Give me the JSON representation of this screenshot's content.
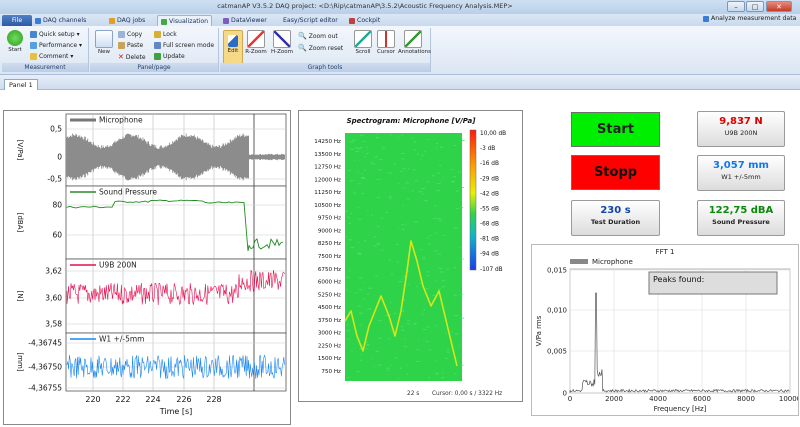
{
  "window": {
    "title": "catmanAP V3.5.2 DAQ project: <D:\\Rip\\catmanAP\\3.5.2\\Acoustic Frequency Analysis.MEP>",
    "buttons": {
      "minimize": "–",
      "maximize": "□",
      "close": "✕"
    }
  },
  "menu_tabs": [
    {
      "label": "File"
    },
    {
      "label": "DAQ channels"
    },
    {
      "label": "DAQ jobs"
    },
    {
      "label": "Visualization"
    },
    {
      "label": "DataViewer"
    },
    {
      "label": "Easy/Script editor"
    },
    {
      "label": "Cockpit"
    }
  ],
  "analyze_label": "Analyze measurement data",
  "ribbon": {
    "measurement": {
      "label": "Measurement",
      "start": "Start",
      "quick_setup": "Quick setup",
      "performance": "Performance",
      "comment": "Comment"
    },
    "panel_page": {
      "label": "Panel/page",
      "new": "New",
      "copy": "Copy",
      "paste": "Paste",
      "delete": "Delete",
      "lock": "Lock",
      "full_screen": "Full screen mode",
      "update": "Update"
    },
    "graph_tools": {
      "label": "Graph tools",
      "edit": "Edit",
      "rzoom": "R-Zoom",
      "hzoom": "H-Zoom",
      "zoom_out": "Zoom out",
      "zoom_reset": "Zoom reset",
      "scroll": "Scroll",
      "cursor": "Cursor",
      "annotations": "Annotations"
    }
  },
  "panel_tab": "Panel 1",
  "timechart": {
    "xlabel": "Time [s]",
    "x_ticks": [
      "220",
      "222",
      "224",
      "226",
      "228"
    ],
    "panels": [
      {
        "name": "Microphone",
        "unit": "[V/Pa]",
        "ticks": [
          "0,5",
          "0",
          "-0,5"
        ]
      },
      {
        "name": "Sound Pressure",
        "unit": "[dBA]",
        "ticks": [
          "80",
          "60"
        ]
      },
      {
        "name": "U9B 200N",
        "unit": "[N]",
        "ticks": [
          "3,62",
          "3,60",
          "3,58"
        ]
      },
      {
        "name": "W1 +/-5mm",
        "unit": "[mm]",
        "ticks": [
          "-4,36745",
          "-4,36750",
          "-4,36755"
        ]
      }
    ]
  },
  "spectrogram": {
    "title": "Spectrogram: Microphone [V/Pa]",
    "y_ticks": [
      "14250 Hz",
      "13500 Hz",
      "12750 Hz",
      "12000 Hz",
      "11250 Hz",
      "10500 Hz",
      "9750 Hz",
      "9000 Hz",
      "8250 Hz",
      "7500 Hz",
      "6750 Hz",
      "6000 Hz",
      "5250 Hz",
      "4500 Hz",
      "3750 Hz",
      "3000 Hz",
      "2250 Hz",
      "1500 Hz",
      "750 Hz"
    ],
    "colorbar": [
      "10,00 dB",
      "-3 dB",
      "-16 dB",
      "-29 dB",
      "-42 dB",
      "-55 dB",
      "-68 dB",
      "-81 dB",
      "-94 dB",
      "-107 dB"
    ],
    "time_label": "22 s",
    "cursor_label": "Cursor: 0,00 s / 3322 Hz"
  },
  "controls": {
    "start": "Start",
    "stop": "Stopp",
    "start_color": "#00ee00",
    "stop_color": "#ff0000"
  },
  "values": [
    {
      "value": "9,837 N",
      "label": "U9B 200N",
      "color": "#dd0000"
    },
    {
      "value": "3,057 mm",
      "label": "W1 +/-5mm",
      "color": "#1177ee"
    },
    {
      "value": "230 s",
      "label": "Test Duration",
      "color": "#1144aa"
    },
    {
      "value": "122,75 dBA",
      "label": "Sound Pressure",
      "color": "#0a8a0a"
    }
  ],
  "fft": {
    "title": "FFT 1",
    "legend": "Microphone",
    "peaks_label": "Peaks found:",
    "ylabel": "V/Pa rms",
    "xlabel": "Frequency [Hz]",
    "y_ticks": [
      "0,015",
      "0,010",
      "0,005",
      "0"
    ],
    "x_ticks": [
      "0",
      "2000",
      "4000",
      "6000",
      "8000",
      "10000"
    ]
  }
}
